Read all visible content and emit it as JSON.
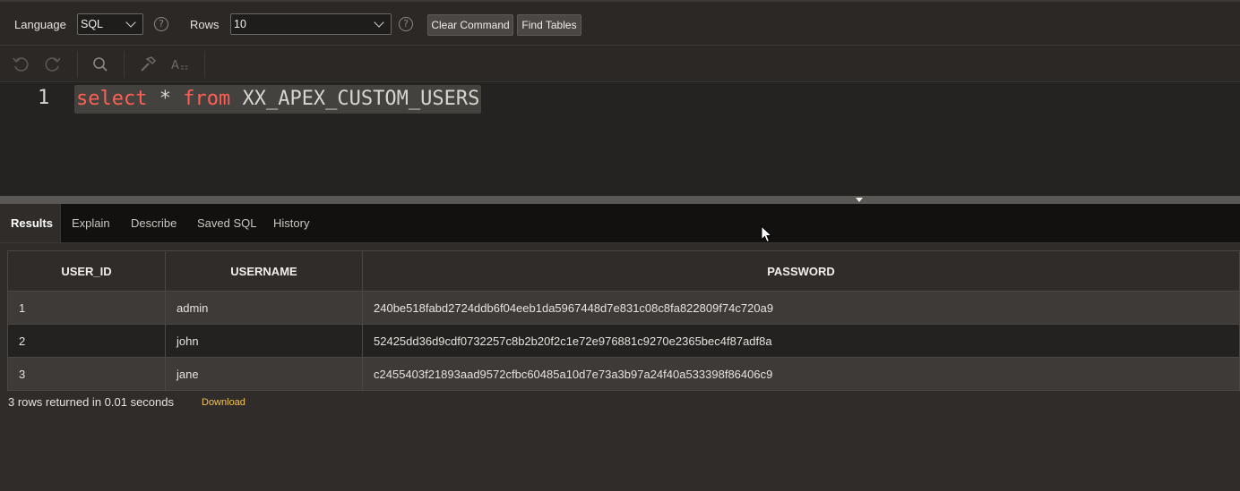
{
  "toolbar": {
    "language_label": "Language",
    "language_value": "SQL",
    "rows_label": "Rows",
    "rows_value": "10",
    "help_glyph": "?",
    "clear_command_label": "Clear Command",
    "find_tables_label": "Find Tables"
  },
  "editor": {
    "line_number": "1",
    "code": {
      "kw1": "select",
      "mid": " * ",
      "kw2": "from",
      "rest": " XX_APEX_CUSTOM_USERS"
    },
    "toolbar_icons": [
      "undo-icon",
      "redo-icon",
      "search-icon",
      "hammer-icon",
      "text-format-icon"
    ]
  },
  "tabs": [
    "Results",
    "Explain",
    "Describe",
    "Saved SQL",
    "History"
  ],
  "results": {
    "columns": [
      "USER_ID",
      "USERNAME",
      "PASSWORD"
    ],
    "rows": [
      [
        "1",
        "admin",
        "240be518fabd2724ddb6f04eeb1da5967448d7e831c08c8fa822809f74c720a9"
      ],
      [
        "2",
        "john",
        "52425dd36d9cdf0732257c8b2b20f2c1e72e976881c9270e2365bec4f87adf8a"
      ],
      [
        "3",
        "jane",
        "c2455403f21893aad9572cfbc60485a10d7e73a3b97a24f40a533398f86406c9"
      ]
    ],
    "summary": "3 rows returned in 0.01 seconds",
    "download_label": "Download"
  },
  "colors": {
    "keyword": "#ff5f54",
    "download_link": "#f2c25c",
    "background": "#2f2c29"
  }
}
